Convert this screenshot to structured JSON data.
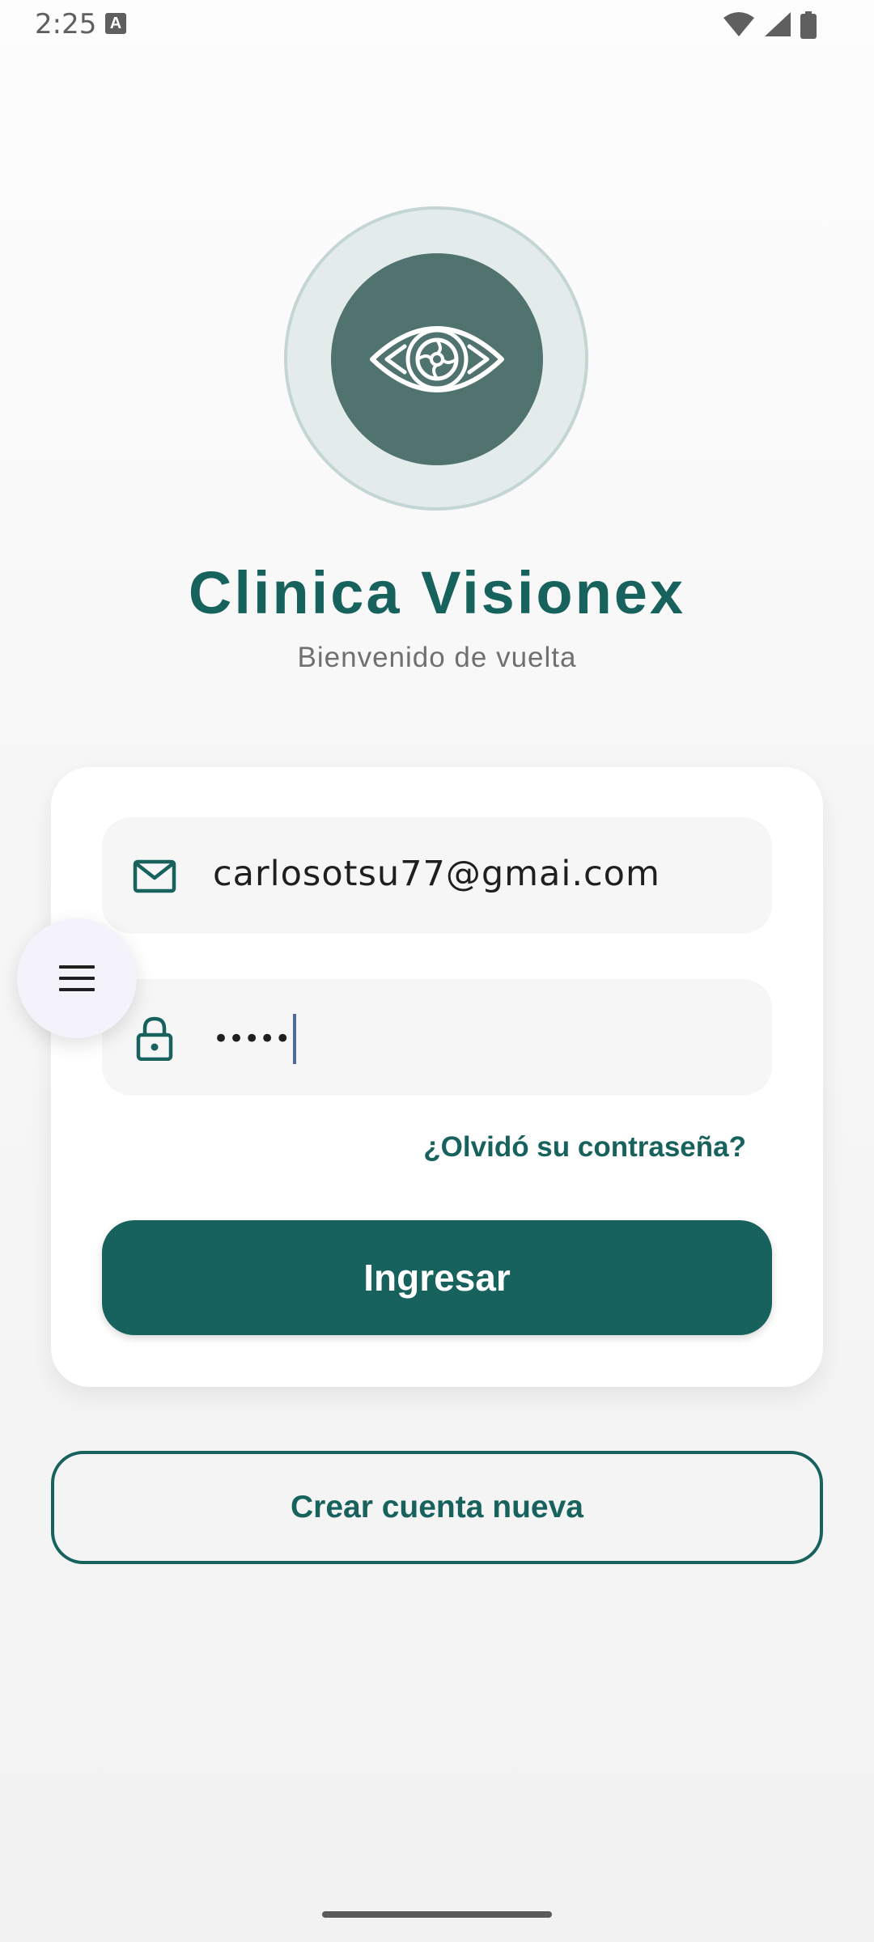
{
  "status_bar": {
    "time": "2:25",
    "notification_icon": "keyboard-a-icon",
    "icons": [
      "wifi-icon",
      "signal-icon",
      "battery-icon"
    ]
  },
  "logo": {
    "icon": "eye-icon"
  },
  "header": {
    "title": "Clinica Visionex",
    "subtitle": "Bienvenido de vuelta"
  },
  "login_form": {
    "email_icon": "mail-icon",
    "email_value": "carlosotsu77@gmai.com",
    "password_icon": "lock-icon",
    "password_value": "•••••",
    "forgot_password_label": "¿Olvidó su contraseña?",
    "submit_label": "Ingresar"
  },
  "create_account_label": "Crear cuenta nueva",
  "floating_menu": {
    "icon": "menu-icon"
  },
  "colors": {
    "primary": "#18625e",
    "logo_circle": "#50736f",
    "logo_ring": "#e4eceb",
    "background": "#f7f7f7",
    "card": "#ffffff",
    "field": "#f6f6f6"
  }
}
